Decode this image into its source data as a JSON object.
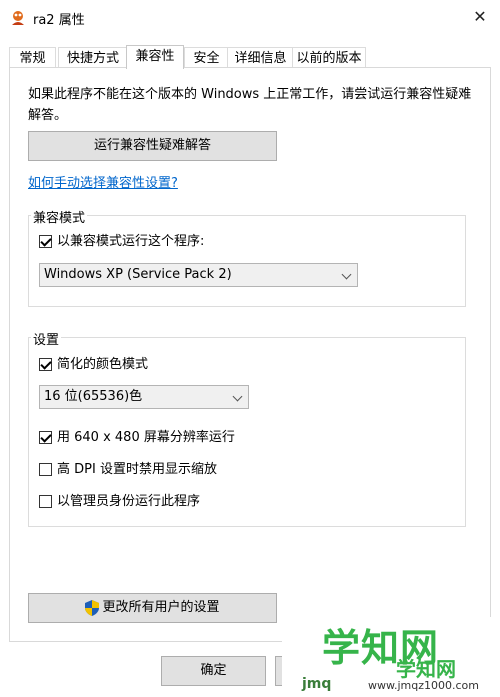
{
  "window": {
    "title": "ra2 属性"
  },
  "tabs": [
    "常规",
    "快捷方式",
    "兼容性",
    "安全",
    "详细信息",
    "以前的版本"
  ],
  "intro_text": "如果此程序不能在这个版本的 Windows 上正常工作，请尝试运行兼容性疑难解答。",
  "troubleshoot_button": "运行兼容性疑难解答",
  "manual_link": "如何手动选择兼容性设置?",
  "compat_mode": {
    "group_label": "兼容模式",
    "checkbox_label": "以兼容模式运行这个程序:",
    "checked": true,
    "selected_os": "Windows XP (Service Pack 2)"
  },
  "settings": {
    "group_label": "设置",
    "reduced_color_label": "简化的颜色模式",
    "reduced_color_checked": true,
    "color_depth": "16 位(65536)色",
    "res_640_label": "用 640 x 480 屏幕分辨率运行",
    "res_640_checked": true,
    "dpi_label": "高 DPI 设置时禁用显示缩放",
    "dpi_checked": false,
    "admin_label": "以管理员身份运行此程序",
    "admin_checked": false
  },
  "all_users_button": "更改所有用户的设置",
  "ok_button": "确定",
  "watermark": {
    "big": "学知网",
    "sub": "学知网",
    "small": "jmq",
    "url": "www.jmqz1000.com"
  },
  "icons": {
    "close": "close-icon",
    "app": "app-icon",
    "shield": "uac-shield-icon",
    "chevron": "chevron-down-icon"
  },
  "colors": {
    "link": "#0066cc",
    "watermark_green": "#36b44a",
    "button_face": "#e1e1e1"
  }
}
